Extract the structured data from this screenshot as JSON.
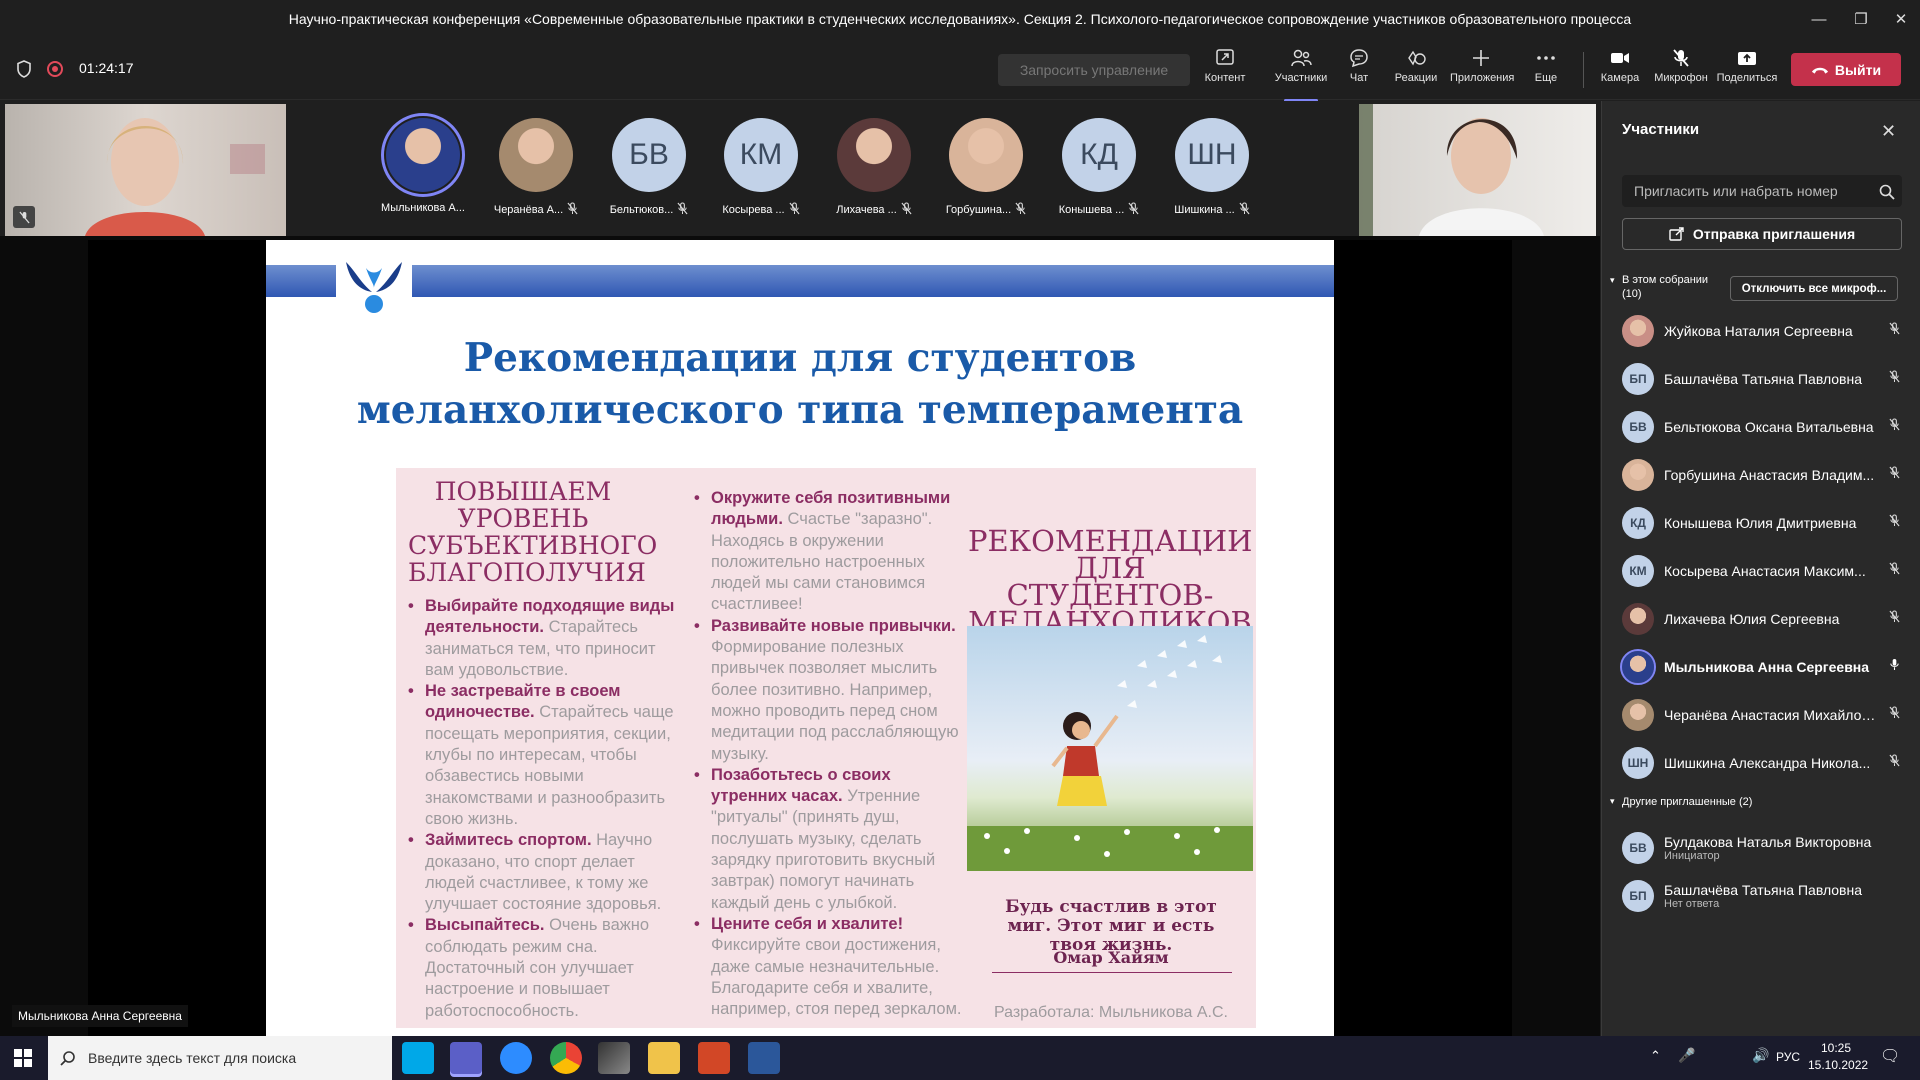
{
  "window": {
    "title": "Научно-практическая конференция «Современные образовательные практики в студенческих исследованиях». Секция 2. Психолого-педагогическое сопровождение участников образовательного процесса"
  },
  "meeting": {
    "timer": "01:24:17",
    "request_control": "Запросить управление"
  },
  "toolbar": {
    "content": "Контент",
    "participants": "Участники",
    "chat": "Чат",
    "reactions": "Реакции",
    "apps": "Приложения",
    "more": "Еще",
    "camera": "Камера",
    "mic": "Микрофон",
    "share": "Поделиться",
    "leave": "Выйти"
  },
  "strip": [
    {
      "label": "Мыльникова А...",
      "initials": "",
      "photo": "#2a3f8c"
    },
    {
      "label": "Черанёва А...",
      "initials": "",
      "photo": "#a58a6e"
    },
    {
      "label": "Бельтюков...",
      "initials": "БВ",
      "photo": ""
    },
    {
      "label": "Косырева ...",
      "initials": "КМ",
      "photo": ""
    },
    {
      "label": "Лихачева ...",
      "initials": "",
      "photo": "#5b3a3a"
    },
    {
      "label": "Горбушина...",
      "initials": "",
      "photo": "#d9b49a"
    },
    {
      "label": "Конышева ...",
      "initials": "КД",
      "photo": ""
    },
    {
      "label": "Шишкина ...",
      "initials": "ШН",
      "photo": ""
    }
  ],
  "slide": {
    "title_line1": "Рекомендации для студентов",
    "title_line2": "меланхолического типа темперамента",
    "left_heading": "ПОВЫШАЕМ УРОВЕНЬ СУБЪЕКТИВНОГО БЛАГОПОЛУЧИЯ",
    "left_items": [
      {
        "bold": "Выбирайте подходящие виды деятельности.",
        "text": " Старайтесь заниматься тем, что приносит вам удовольствие."
      },
      {
        "bold": "Не застревайте в своем одиночестве.",
        "text": " Старайтесь чаще посещать мероприятия, секции, клубы по интересам, чтобы обзавестись новыми знакомствами и разнообразить свою жизнь."
      },
      {
        "bold": "Займитесь спортом.",
        "text": " Научно доказано, что спорт делает людей счастливее, к тому же улучшает состояние здоровья."
      },
      {
        "bold": "Высыпайтесь.",
        "text": " Очень важно соблюдать режим сна. Достаточный сон улучшает настроение и повышает работоспособность."
      }
    ],
    "mid_items": [
      {
        "bold": "Окружите себя позитивными людьми.",
        "text": " Счастье \"заразно\". Находясь в окружении положительно настроенных людей мы сами становимся счастливее!"
      },
      {
        "bold": "Развивайте новые привычки.",
        "text": " Формирование полезных привычек  позволяет мыслить более позитивно. Например, можно проводить перед сном медитации под расслабляющую музыку."
      },
      {
        "bold": "Позаботьтесь о своих утренних часах.",
        "text": " Утренние \"ритуалы\" (принять душ, послушать музыку, сделать зарядку приготовить вкусный завтрак) помогут начинать каждый день с улыбкой."
      },
      {
        "bold": "Цените себя и хвалите!",
        "text": " Фиксируйте свои достижения, даже самые незначительные. Благодарите себя и хвалите, например, стоя перед зеркалом."
      }
    ],
    "right_heading": "РЕКОМЕНДАЦИИ ДЛЯ СТУДЕНТОВ-МЕЛАНХОЛИКОВ",
    "quote": "Будь счастлив в этот миг. Этот миг и есть твоя жизнь.",
    "quote_author": "Омар Хайям",
    "credit": "Разработала: Мыльникова А.С."
  },
  "speaker_tag": "Мыльникова Анна Сергеевна",
  "panel": {
    "title": "Участники",
    "search_placeholder": "Пригласить или набрать номер",
    "invite": "Отправка приглашения",
    "in_meeting": "В этом собрании",
    "in_meeting_count": "(10)",
    "mute_all": "Отключить все микроф...",
    "participants": [
      {
        "name": "Жуйкова Наталия Сергеевна",
        "initials": "",
        "photo": "#c98f86",
        "muted": true,
        "bold": false
      },
      {
        "name": "Башлачёва Татьяна Павловна",
        "initials": "БП",
        "photo": "",
        "muted": true,
        "bold": false
      },
      {
        "name": "Бельтюкова Оксана Витальевна",
        "initials": "БВ",
        "photo": "",
        "muted": true,
        "bold": false
      },
      {
        "name": "Горбушина Анастасия Владим...",
        "initials": "",
        "photo": "#d9b49a",
        "muted": true,
        "bold": false
      },
      {
        "name": "Конышева Юлия Дмитриевна",
        "initials": "КД",
        "photo": "",
        "muted": true,
        "bold": false
      },
      {
        "name": "Косырева Анастасия Максим...",
        "initials": "КМ",
        "photo": "",
        "muted": true,
        "bold": false
      },
      {
        "name": "Лихачева Юлия Сергеевна",
        "initials": "",
        "photo": "#5b3a3a",
        "muted": true,
        "bold": false
      },
      {
        "name": "Мыльникова Анна Сергеевна",
        "initials": "",
        "photo": "#2a3f8c",
        "muted": false,
        "bold": true
      },
      {
        "name": "Черанёва Анастасия Михайлов...",
        "initials": "",
        "photo": "#a58a6e",
        "muted": true,
        "bold": false
      },
      {
        "name": "Шишкина Александра Никола...",
        "initials": "ШН",
        "photo": "",
        "muted": true,
        "bold": false
      }
    ],
    "others": "Другие приглашенные (2)",
    "invited": [
      {
        "name": "Булдакова Наталья Викторовна",
        "initials": "БВ",
        "status": "Инициатор"
      },
      {
        "name": "Башлачёва Татьяна Павловна",
        "initials": "БП",
        "status": "Нет ответа"
      }
    ]
  },
  "taskbar": {
    "search": "Введите здесь текст для поиска",
    "lang": "РУС",
    "time": "10:25",
    "date": "15.10.2022"
  }
}
